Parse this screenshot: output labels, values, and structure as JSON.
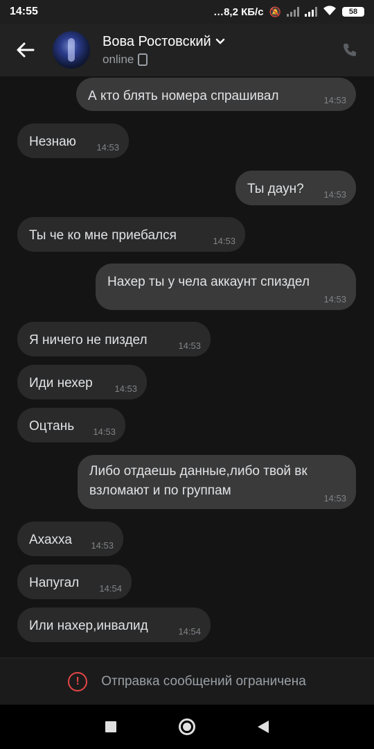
{
  "statusbar": {
    "time": "14:55",
    "network": "…8,2 КБ/с",
    "battery": "58"
  },
  "header": {
    "name": "Вова Ростовский",
    "status": "online"
  },
  "messages": [
    {
      "text": "А кто блять номера спрашивал",
      "time": "14:53",
      "dir": "out"
    },
    {
      "text": "Незнаю",
      "time": "14:53",
      "dir": "in"
    },
    {
      "text": "Ты даун?",
      "time": "14:53",
      "dir": "out"
    },
    {
      "text": "Ты че ко мне приебался",
      "time": "14:53",
      "dir": "in"
    },
    {
      "text": "Нахер ты у чела аккаунт спиздел",
      "time": "14:53",
      "dir": "out"
    },
    {
      "text": "Я ничего не пиздел",
      "time": "14:53",
      "dir": "in"
    },
    {
      "text": "Иди нехер",
      "time": "14:53",
      "dir": "in"
    },
    {
      "text": "Оцтань",
      "time": "14:53",
      "dir": "in"
    },
    {
      "text": "Либо отдаешь данные,либо твой вк взломают и по группам",
      "time": "14:53",
      "dir": "out"
    },
    {
      "text": "Ахахха",
      "time": "14:53",
      "dir": "in"
    },
    {
      "text": "Напугал",
      "time": "14:54",
      "dir": "in"
    },
    {
      "text": "Или нахер,инвалид",
      "time": "14:54",
      "dir": "in"
    }
  ],
  "restriction": {
    "text": "Отправка сообщений ограничена"
  },
  "colors": {
    "warning": "#e64646",
    "bubble_in": "#2a2a2a",
    "bubble_out": "#3a3a3a"
  }
}
